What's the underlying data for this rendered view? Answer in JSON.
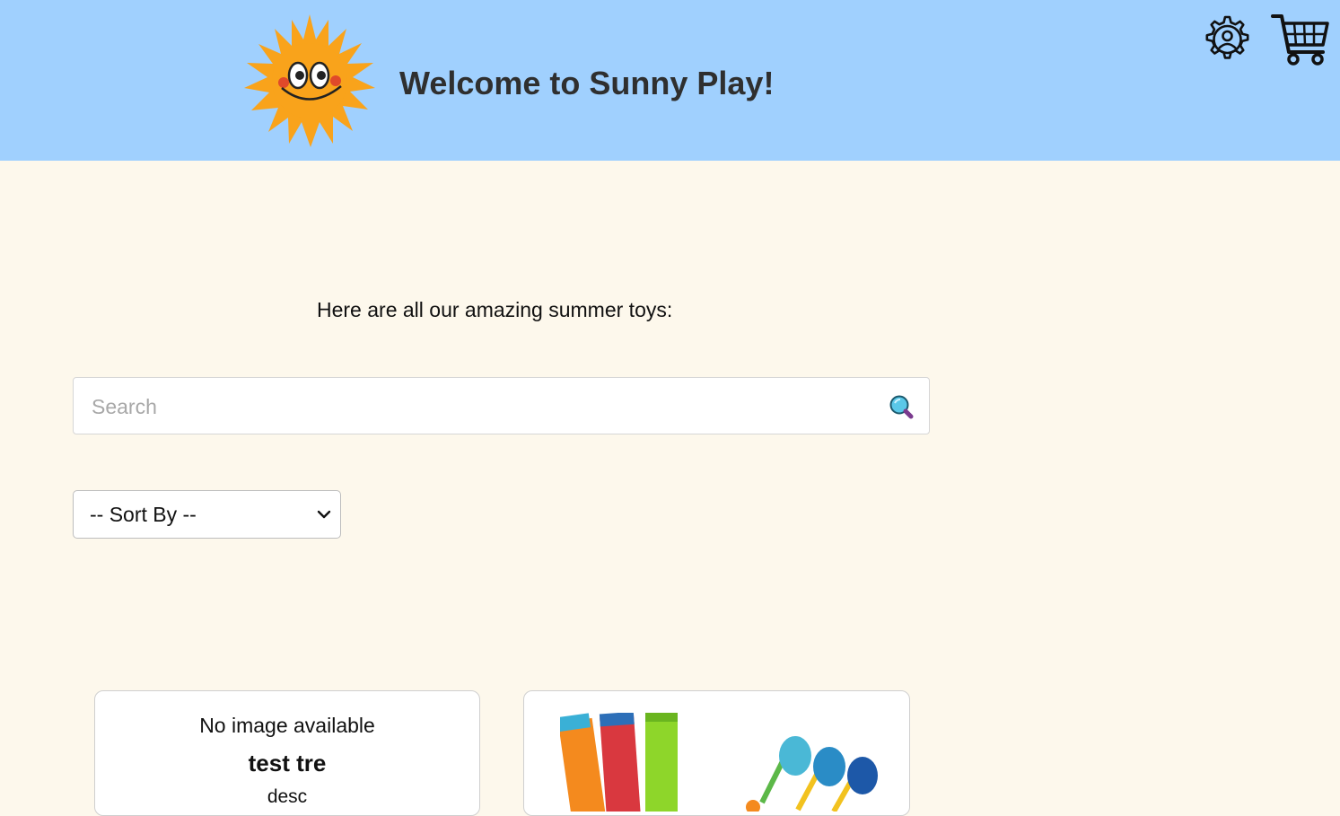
{
  "header": {
    "title": "Welcome to Sunny Play!",
    "background": "#a0d0fe",
    "logo_icon": "smiling-sun-icon",
    "settings_icon": "user-settings-gear-icon",
    "cart_icon": "shopping-cart-icon"
  },
  "main": {
    "intro": "Here are all our amazing summer toys:",
    "search": {
      "placeholder": "Search",
      "value": "",
      "icon": "magnifier-icon"
    },
    "sort": {
      "selected": "-- Sort By --"
    }
  },
  "products": [
    {
      "image_text": "No image available",
      "name": "test tre",
      "description": "desc"
    },
    {
      "image": "pool-noodles-and-water-blasters"
    }
  ],
  "colors": {
    "page_bg": "#fdf8ec",
    "title_text": "#2f2f2f",
    "sun": "#f9a31b"
  }
}
